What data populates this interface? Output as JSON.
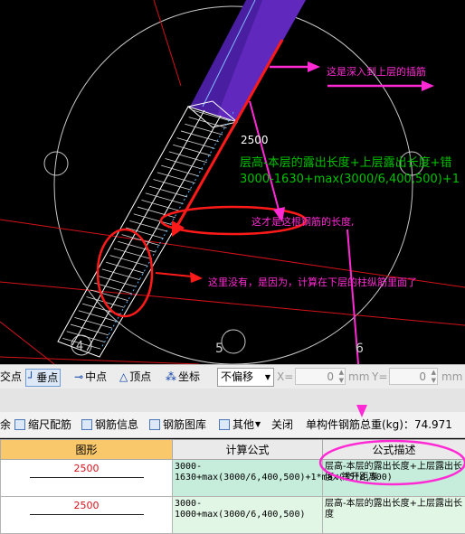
{
  "colors": {
    "annotation_magenta": "#ff2ad4",
    "arrow_red": "#ff1a1a",
    "dim_green": "#00c000",
    "rebar_purple": "#5a1fb0",
    "axis_red": "#d4121a",
    "highlight_header": "#f9c86b"
  },
  "viewport": {
    "dim_length": "2500",
    "formula_text_1": "层高-本层的露出长度+上层露出长度+错",
    "formula_text_2": "3000-1630+max(3000/6,400,500)+1",
    "annotation_top": "这是深入到上层的插筋",
    "annotation_middle": "这才是这根钢筋的长度,",
    "annotation_bottom": "这里没有，是因为，计算在下层的柱纵筋里面了",
    "axis_labels": [
      "4",
      "5",
      "6"
    ]
  },
  "snap_toolbar": {
    "items": [
      {
        "label": "交点",
        "icon": ""
      },
      {
        "label": "垂点",
        "icon": "perpendicular-icon",
        "checked": true
      },
      {
        "label": "中点",
        "icon": "midpoint-icon"
      },
      {
        "label": "顶点",
        "icon": "vertex-icon"
      },
      {
        "label": "坐标",
        "icon": "coordinate-icon"
      }
    ],
    "offset_select": "不偏移",
    "x_label": "X=",
    "x_value": "0",
    "x_unit": "mm",
    "y_label": "Y=",
    "y_value": "0",
    "y_unit": "mm"
  },
  "rebar_toolbar": {
    "items": [
      {
        "label": "余",
        "icon": ""
      },
      {
        "label": "缩尺配筋",
        "icon": "scale-rebar-icon"
      },
      {
        "label": "钢筋信息",
        "icon": "rebar-info-icon"
      },
      {
        "label": "钢筋图库",
        "icon": "rebar-library-icon"
      },
      {
        "label": "其他",
        "icon": "other-icon"
      },
      {
        "label": "关闭",
        "icon": ""
      }
    ],
    "total_weight_label": "单构件钢筋总重(kg)：",
    "total_weight_value": "74.971"
  },
  "table": {
    "headers": [
      "图形",
      "计算公式",
      "公式描述"
    ],
    "rows": [
      {
        "shape_length": "2500",
        "formula": "3000-1630+max(3000/6,400,500)+1*max(35*d,500)",
        "description": "层高-本层的露出长度+上层露出长度+错开距离"
      },
      {
        "shape_length": "2500",
        "formula": "3000-1000+max(3000/6,400,500)",
        "description": "层高-本层的露出长度+上层露出长度"
      }
    ]
  }
}
